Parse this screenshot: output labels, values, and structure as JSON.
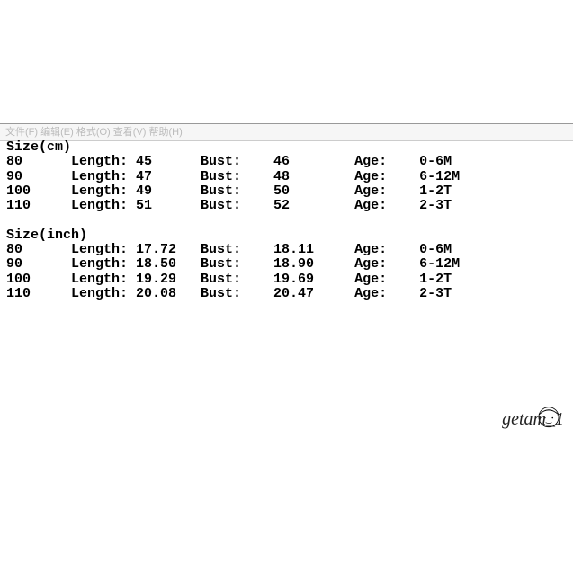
{
  "menubar": {
    "raw": "文件(F)  编辑(E)  格式(O)  查看(V)  帮助(H)"
  },
  "sections": {
    "cm": {
      "title": "Size(cm)",
      "rows": [
        {
          "size": "80",
          "length": "45",
          "bust": "46",
          "age": "0-6M"
        },
        {
          "size": "90",
          "length": "47",
          "bust": "48",
          "age": "6-12M"
        },
        {
          "size": "100",
          "length": "49",
          "bust": "50",
          "age": "1-2T"
        },
        {
          "size": "110",
          "length": "51",
          "bust": "52",
          "age": "2-3T"
        }
      ]
    },
    "inch": {
      "title": "Size(inch)",
      "rows": [
        {
          "size": "80",
          "length": "17.72",
          "bust": "18.11",
          "age": "0-6M"
        },
        {
          "size": "90",
          "length": "18.50",
          "bust": "18.90",
          "age": "6-12M"
        },
        {
          "size": "100",
          "length": "19.29",
          "bust": "19.69",
          "age": "1-2T"
        },
        {
          "size": "110",
          "length": "20.08",
          "bust": "20.47",
          "age": "2-3T"
        }
      ]
    }
  },
  "labels": {
    "length": "Length:",
    "bust": "Bust:",
    "age": "Age:"
  },
  "watermark": "getam_1"
}
